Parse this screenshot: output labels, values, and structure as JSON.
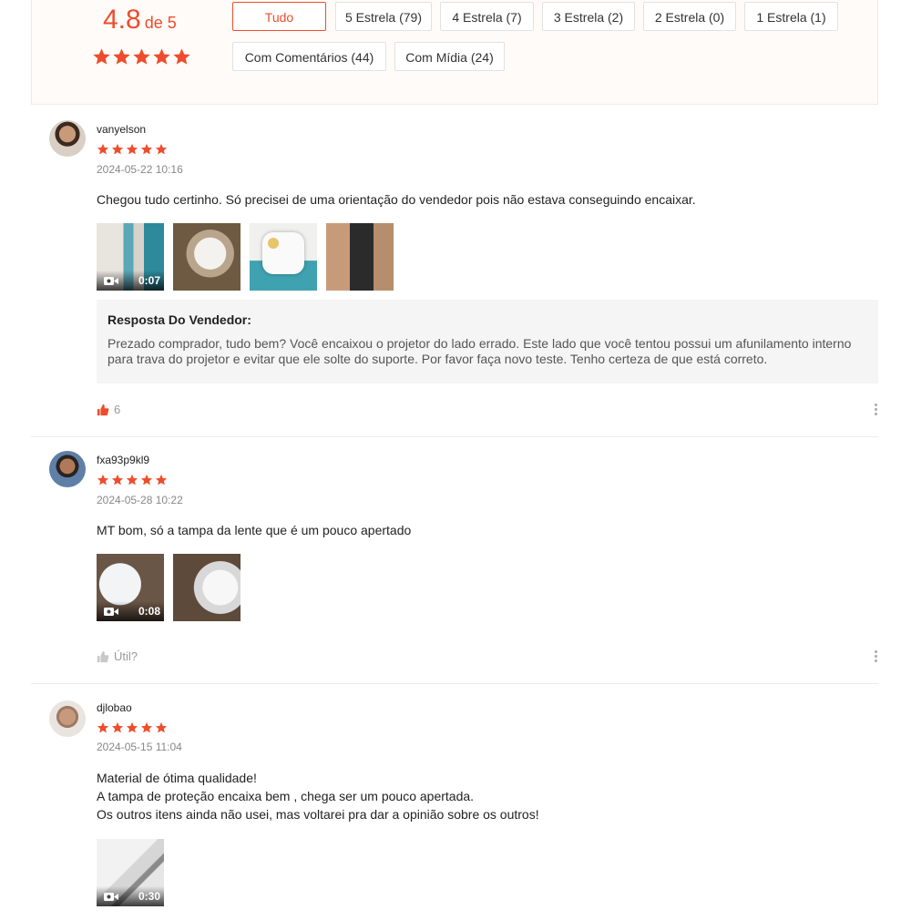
{
  "summary": {
    "rating": "4.8",
    "of_label": "de 5",
    "filters": [
      {
        "label": "Tudo",
        "active": true
      },
      {
        "label": "5 Estrela (79)"
      },
      {
        "label": "4 Estrela (7)"
      },
      {
        "label": "3 Estrela (2)"
      },
      {
        "label": "2 Estrela (0)"
      },
      {
        "label": "1 Estrela (1)"
      },
      {
        "label": "Com Comentários (44)"
      },
      {
        "label": "Com Mídia (24)"
      }
    ],
    "stars": 5
  },
  "colors": {
    "accent": "#ee4d2d"
  },
  "reviews": [
    {
      "username": "vanyelson",
      "stars": 5,
      "date": "2024-05-22 10:16",
      "text": "Chegou tudo certinho. Só precisei de uma orientação do vendedor pois não estava conseguindo encaixar.",
      "video_duration": "0:07",
      "media_count": 4,
      "seller_reply": {
        "title": "Resposta Do Vendedor:",
        "text": "Prezado comprador, tudo bem? Você encaixou o projetor do lado errado. Este lado que você tentou possui um afunilamento interno para trava do projetor e evitar que ele solte do suporte. Por favor faça novo teste. Tenho certeza de que está correto."
      },
      "likes": "6",
      "liked": true
    },
    {
      "username": "fxa93p9kl9",
      "stars": 5,
      "date": "2024-05-28 10:22",
      "text": "MT bom, só a tampa da lente que é um pouco apertado",
      "video_duration": "0:08",
      "media_count": 2,
      "like_label": "Útil?",
      "liked": false
    },
    {
      "username": "djlobao",
      "stars": 5,
      "date": "2024-05-15 11:04",
      "text": "Material de ótima qualidade!\nA tampa de proteção encaixa bem , chega ser um pouco apertada.\nOs outros itens ainda não usei, mas voltarei pra dar a opinião sobre os outros!",
      "video_duration": "0:30",
      "media_count": 1
    }
  ]
}
